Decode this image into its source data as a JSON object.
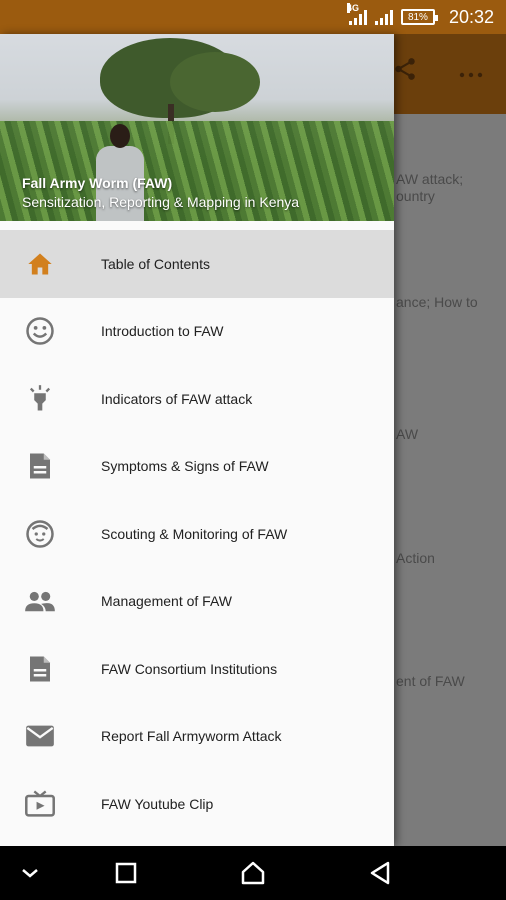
{
  "status_bar": {
    "network": "4G",
    "battery": "81%",
    "time": "20:32"
  },
  "header": {
    "title": "Fall Army Worm (FAW)",
    "subtitle": "Sensitization, Reporting & Mapping in Kenya"
  },
  "menu": [
    {
      "label": "Table of Contents",
      "icon": "home-icon"
    },
    {
      "label": "Introduction to FAW",
      "icon": "smiley-icon"
    },
    {
      "label": "Indicators of FAW attack",
      "icon": "lightbulb-icon"
    },
    {
      "label": "Symptoms & Signs of FAW",
      "icon": "document-icon"
    },
    {
      "label": "Scouting & Monitoring of FAW",
      "icon": "child-face-icon"
    },
    {
      "label": "Management of FAW",
      "icon": "people-icon"
    },
    {
      "label": "FAW Consortium Institutions",
      "icon": "document-icon"
    },
    {
      "label": "Report Fall Armyworm Attack",
      "icon": "mail-icon"
    },
    {
      "label": "FAW Youtube Clip",
      "icon": "tv-icon"
    }
  ],
  "background": {
    "lines": [
      "AW attack;",
      "ountry",
      "ance; How to",
      "AW",
      "Action",
      "ent of FAW"
    ]
  },
  "colors": {
    "status_bar": "#9b5b0f",
    "accent": "#d2801e",
    "icon_gray": "#757575"
  }
}
